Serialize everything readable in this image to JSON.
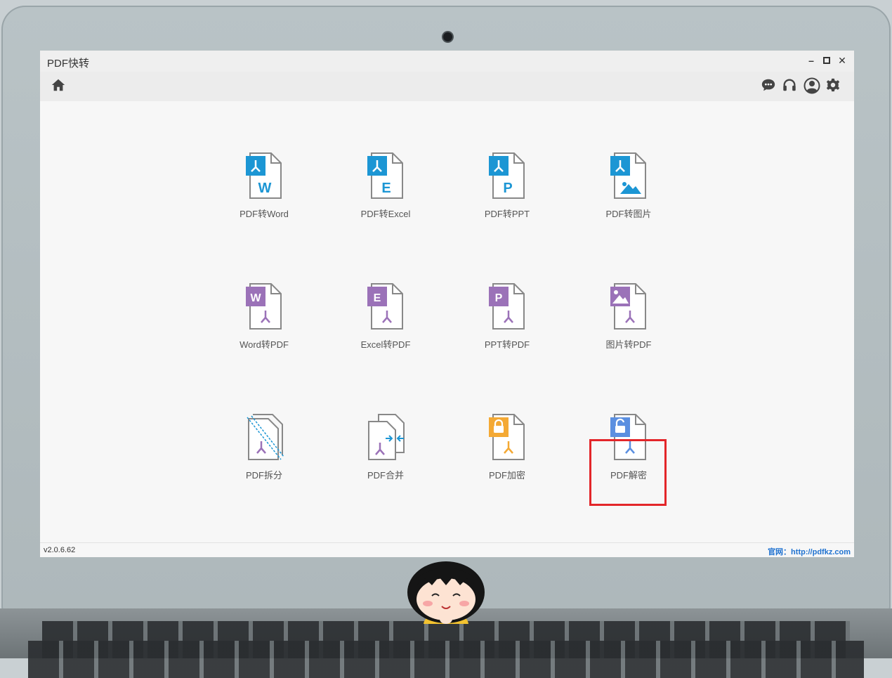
{
  "window": {
    "title": "PDF快转",
    "controls": [
      "minimize",
      "maximize",
      "close"
    ]
  },
  "toolbar": {
    "left": [
      "home-icon"
    ],
    "right": [
      "chat-icon",
      "headset-icon",
      "user-icon",
      "gear-icon"
    ]
  },
  "tools": [
    {
      "label": "PDF转Word",
      "glyph": "W",
      "style": "pdf-to"
    },
    {
      "label": "PDF转Excel",
      "glyph": "E",
      "style": "pdf-to"
    },
    {
      "label": "PDF转PPT",
      "glyph": "P",
      "style": "pdf-to"
    },
    {
      "label": "PDF转图片",
      "glyph": "image",
      "style": "pdf-to"
    },
    {
      "label": "Word转PDF",
      "glyph": "W",
      "style": "to-pdf"
    },
    {
      "label": "Excel转PDF",
      "glyph": "E",
      "style": "to-pdf"
    },
    {
      "label": "PPT转PDF",
      "glyph": "P",
      "style": "to-pdf"
    },
    {
      "label": "图片转PDF",
      "glyph": "image",
      "style": "to-pdf"
    },
    {
      "label": "PDF拆分",
      "glyph": "split",
      "style": "util"
    },
    {
      "label": "PDF合并",
      "glyph": "merge",
      "style": "util"
    },
    {
      "label": "PDF加密",
      "glyph": "lock",
      "style": "util"
    },
    {
      "label": "PDF解密",
      "glyph": "unlock",
      "style": "util"
    }
  ],
  "status": {
    "version": "v2.0.6.62",
    "website": "官网：http://pdfkz.com"
  },
  "colors": {
    "blue": "#1c96d4",
    "purple": "#9b72b8",
    "orange": "#f4a934",
    "unlock_blue": "#5b8fe0",
    "highlight": "#e3262a"
  }
}
